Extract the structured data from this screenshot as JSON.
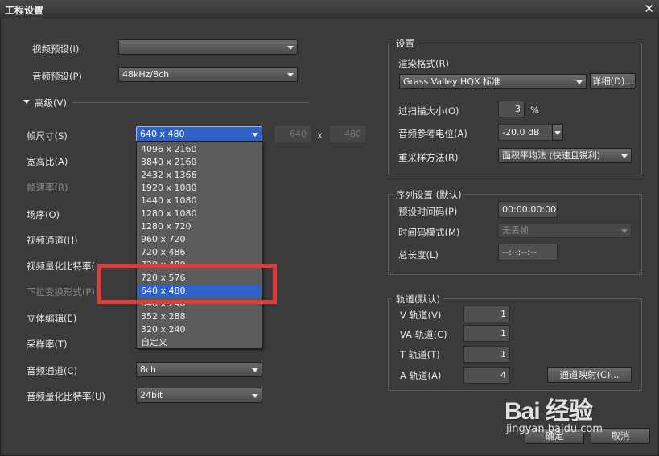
{
  "window": {
    "title": "工程设置",
    "close_glyph": "✕"
  },
  "left": {
    "video_preset": {
      "label": "视频预设(I)",
      "value": ""
    },
    "audio_preset": {
      "label": "音频预设(P)",
      "value": "48kHz/8ch"
    },
    "advanced": {
      "label": "高级(V)"
    },
    "frame_size": {
      "label": "帧尺寸(S)",
      "value": "640 x 480",
      "width": "640",
      "x_sep": "x",
      "height": "480"
    },
    "aspect_ratio": {
      "label": "宽高比(A)"
    },
    "frame_rate": {
      "label": "帧速率(R)"
    },
    "field_order": {
      "label": "场序(O)"
    },
    "video_channel": {
      "label": "视频通道(H)"
    },
    "video_bitdepth": {
      "label": "视频量化比特率("
    },
    "pulldown": {
      "label": "下拉变换形式(P)"
    },
    "stereo_edit": {
      "label": "立体编辑(E)"
    },
    "sample_rate": {
      "label": "采样率(T)"
    },
    "audio_channel": {
      "label": "音频通道(C)",
      "value": "8ch"
    },
    "audio_bitdepth": {
      "label": "音频量化比特率(U)",
      "value": "24bit"
    }
  },
  "frame_size_dropdown": {
    "items": [
      "4096 x 2160",
      "3840 x 2160",
      "2432 x 1366",
      "1920 x 1080",
      "1440 x 1080",
      "1280 x 1080",
      "1280 x 720",
      "960 x 720",
      "720 x 486",
      "720 x 480",
      "720 x 576",
      "640 x 480",
      "640 x 240",
      "352 x 288",
      "320 x 240",
      "自定义"
    ],
    "selected_index": 11
  },
  "settings_group": {
    "title": "设置",
    "render_format": {
      "label": "渲染格式(R)",
      "value": "Grass Valley HQX 标准",
      "detail_button": "详细(D)..."
    },
    "overscan": {
      "label": "过扫描大小(O)",
      "value": "3",
      "unit": "%"
    },
    "audio_ref_level": {
      "label": "音频参考电位(A)",
      "value": "-20.0 dB"
    },
    "resample": {
      "label": "重采样方法(R)",
      "value": "面积平均法 (快速且锐利)"
    }
  },
  "sequence_group": {
    "title": "序列设置 (默认)",
    "preset_timecode": {
      "label": "预设时间码(P)",
      "value": "00:00:00:00"
    },
    "timecode_mode": {
      "label": "时间码模式(M)",
      "value": "无丢帧"
    },
    "total_length": {
      "label": "总长度(L)",
      "value": "--:--:--:--"
    }
  },
  "tracks_group": {
    "title": "轨道(默认)",
    "v_track": {
      "label": "V 轨道(V)",
      "value": "1"
    },
    "va_track": {
      "label": "VA 轨道(C)",
      "value": "1"
    },
    "t_track": {
      "label": "T 轨道(T)",
      "value": "1"
    },
    "a_track": {
      "label": "A 轨道(A)",
      "value": "4"
    },
    "channel_map_button": "通道映射(C)..."
  },
  "footer": {
    "ok": "确定",
    "cancel": "取消"
  },
  "watermark": {
    "brand": "Bai  经验",
    "sub": "jingyan.baidu.com"
  },
  "colors": {
    "selection": "#2f62c9",
    "annotation_box": "#e03a3a",
    "background": "#3b3b3b"
  }
}
